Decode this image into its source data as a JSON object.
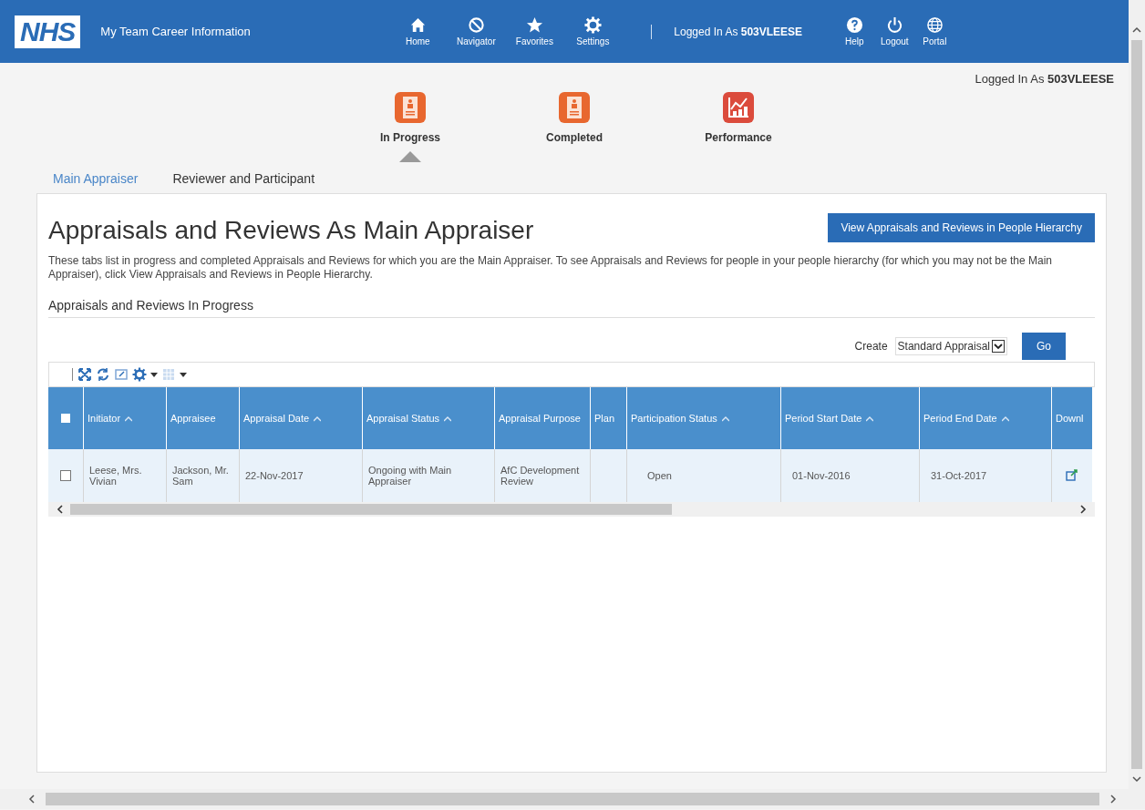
{
  "header": {
    "logo": "NHS",
    "title": "My Team Career Information",
    "nav": [
      {
        "label": "Home"
      },
      {
        "label": "Navigator"
      },
      {
        "label": "Favorites"
      },
      {
        "label": "Settings"
      }
    ],
    "logged_in": "Logged In As **503VLEESE**",
    "tools": [
      {
        "label": "Help"
      },
      {
        "label": "Logout"
      },
      {
        "label": "Portal"
      }
    ]
  },
  "logged_in_line": "Logged In As **503VLEESE**",
  "tiles": [
    {
      "label": "In Progress",
      "selected": true
    },
    {
      "label": "Completed",
      "selected": false
    },
    {
      "label": "Performance",
      "selected": false
    }
  ],
  "subtabs": [
    {
      "label": "Main Appraiser",
      "selected": true
    },
    {
      "label": "Reviewer and Participant",
      "selected": false
    }
  ],
  "page": {
    "title": "Appraisals and Reviews As Main Appraiser",
    "action_button": "View Appraisals and Reviews in People Hierarchy",
    "description": "These tabs list in progress and completed Appraisals and Reviews for which you are the Main Appraiser. To see Appraisals and Reviews for people in your people hierarchy (for which you may not be the Main Appraiser), click View Appraisals and Reviews in People Hierarchy.",
    "section_title": "Appraisals and Reviews In Progress",
    "create": {
      "label": "Create",
      "value": "Standard Appraisal",
      "button": "Go"
    }
  },
  "table": {
    "select_all": {
      "checked": false
    },
    "columns": [
      {
        "label": "Initiator",
        "sortable": true
      },
      {
        "label": "Appraisee",
        "sortable": false
      },
      {
        "label": "Appraisal Date",
        "sortable": true
      },
      {
        "label": "Appraisal Status",
        "sortable": true
      },
      {
        "label": "Appraisal Purpose",
        "sortable": false
      },
      {
        "label": "Plan",
        "sortable": false
      },
      {
        "label": "Participation Status",
        "sortable": true
      },
      {
        "label": "Period Start Date",
        "sortable": true
      },
      {
        "label": "Period End Date",
        "sortable": true
      },
      {
        "label": "Downl",
        "sortable": false
      }
    ],
    "rows": [
      {
        "checked": false,
        "cells": [
          "Leese, Mrs. Vivian",
          "Jackson, Mr. Sam",
          "22-Nov-2017",
          "Ongoing with Main Appraiser",
          "AfC Development Review",
          "",
          "Open",
          "01-Nov-2016",
          "31-Oct-2017"
        ],
        "download": true
      }
    ]
  }
}
